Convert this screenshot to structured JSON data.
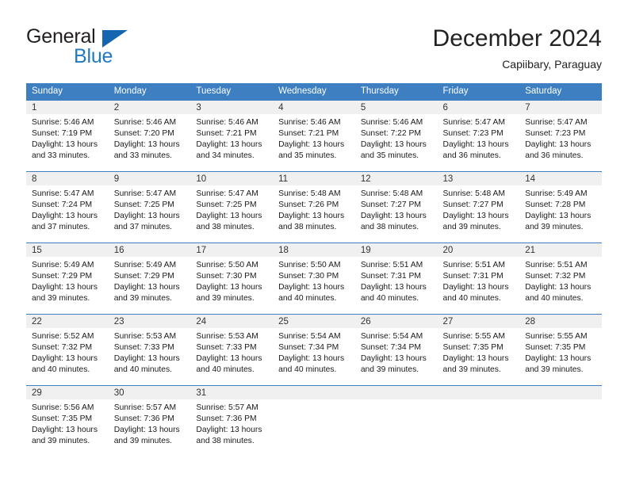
{
  "logo": {
    "primary_text": "General",
    "secondary_text": "Blue",
    "triangle_icon": "triangle-icon",
    "primary_color": "#231f20",
    "secondary_color": "#1f7ac4",
    "triangle_color": "#1565b0"
  },
  "header": {
    "title": "December 2024",
    "subtitle": "Capiibary, Paraguay"
  },
  "theme": {
    "header_bg": "#3d7fc1",
    "header_text": "#ffffff",
    "daynum_bg": "#f0f0f0",
    "row_border": "#3d7fc1",
    "body_text": "#1a1a1a"
  },
  "calendar": {
    "weekday_headers": [
      "Sunday",
      "Monday",
      "Tuesday",
      "Wednesday",
      "Thursday",
      "Friday",
      "Saturday"
    ],
    "weeks": [
      [
        {
          "day": "1",
          "sunrise": "Sunrise: 5:46 AM",
          "sunset": "Sunset: 7:19 PM",
          "daylight_line1": "Daylight: 13 hours",
          "daylight_line2": "and 33 minutes."
        },
        {
          "day": "2",
          "sunrise": "Sunrise: 5:46 AM",
          "sunset": "Sunset: 7:20 PM",
          "daylight_line1": "Daylight: 13 hours",
          "daylight_line2": "and 33 minutes."
        },
        {
          "day": "3",
          "sunrise": "Sunrise: 5:46 AM",
          "sunset": "Sunset: 7:21 PM",
          "daylight_line1": "Daylight: 13 hours",
          "daylight_line2": "and 34 minutes."
        },
        {
          "day": "4",
          "sunrise": "Sunrise: 5:46 AM",
          "sunset": "Sunset: 7:21 PM",
          "daylight_line1": "Daylight: 13 hours",
          "daylight_line2": "and 35 minutes."
        },
        {
          "day": "5",
          "sunrise": "Sunrise: 5:46 AM",
          "sunset": "Sunset: 7:22 PM",
          "daylight_line1": "Daylight: 13 hours",
          "daylight_line2": "and 35 minutes."
        },
        {
          "day": "6",
          "sunrise": "Sunrise: 5:47 AM",
          "sunset": "Sunset: 7:23 PM",
          "daylight_line1": "Daylight: 13 hours",
          "daylight_line2": "and 36 minutes."
        },
        {
          "day": "7",
          "sunrise": "Sunrise: 5:47 AM",
          "sunset": "Sunset: 7:23 PM",
          "daylight_line1": "Daylight: 13 hours",
          "daylight_line2": "and 36 minutes."
        }
      ],
      [
        {
          "day": "8",
          "sunrise": "Sunrise: 5:47 AM",
          "sunset": "Sunset: 7:24 PM",
          "daylight_line1": "Daylight: 13 hours",
          "daylight_line2": "and 37 minutes."
        },
        {
          "day": "9",
          "sunrise": "Sunrise: 5:47 AM",
          "sunset": "Sunset: 7:25 PM",
          "daylight_line1": "Daylight: 13 hours",
          "daylight_line2": "and 37 minutes."
        },
        {
          "day": "10",
          "sunrise": "Sunrise: 5:47 AM",
          "sunset": "Sunset: 7:25 PM",
          "daylight_line1": "Daylight: 13 hours",
          "daylight_line2": "and 38 minutes."
        },
        {
          "day": "11",
          "sunrise": "Sunrise: 5:48 AM",
          "sunset": "Sunset: 7:26 PM",
          "daylight_line1": "Daylight: 13 hours",
          "daylight_line2": "and 38 minutes."
        },
        {
          "day": "12",
          "sunrise": "Sunrise: 5:48 AM",
          "sunset": "Sunset: 7:27 PM",
          "daylight_line1": "Daylight: 13 hours",
          "daylight_line2": "and 38 minutes."
        },
        {
          "day": "13",
          "sunrise": "Sunrise: 5:48 AM",
          "sunset": "Sunset: 7:27 PM",
          "daylight_line1": "Daylight: 13 hours",
          "daylight_line2": "and 39 minutes."
        },
        {
          "day": "14",
          "sunrise": "Sunrise: 5:49 AM",
          "sunset": "Sunset: 7:28 PM",
          "daylight_line1": "Daylight: 13 hours",
          "daylight_line2": "and 39 minutes."
        }
      ],
      [
        {
          "day": "15",
          "sunrise": "Sunrise: 5:49 AM",
          "sunset": "Sunset: 7:29 PM",
          "daylight_line1": "Daylight: 13 hours",
          "daylight_line2": "and 39 minutes."
        },
        {
          "day": "16",
          "sunrise": "Sunrise: 5:49 AM",
          "sunset": "Sunset: 7:29 PM",
          "daylight_line1": "Daylight: 13 hours",
          "daylight_line2": "and 39 minutes."
        },
        {
          "day": "17",
          "sunrise": "Sunrise: 5:50 AM",
          "sunset": "Sunset: 7:30 PM",
          "daylight_line1": "Daylight: 13 hours",
          "daylight_line2": "and 39 minutes."
        },
        {
          "day": "18",
          "sunrise": "Sunrise: 5:50 AM",
          "sunset": "Sunset: 7:30 PM",
          "daylight_line1": "Daylight: 13 hours",
          "daylight_line2": "and 40 minutes."
        },
        {
          "day": "19",
          "sunrise": "Sunrise: 5:51 AM",
          "sunset": "Sunset: 7:31 PM",
          "daylight_line1": "Daylight: 13 hours",
          "daylight_line2": "and 40 minutes."
        },
        {
          "day": "20",
          "sunrise": "Sunrise: 5:51 AM",
          "sunset": "Sunset: 7:31 PM",
          "daylight_line1": "Daylight: 13 hours",
          "daylight_line2": "and 40 minutes."
        },
        {
          "day": "21",
          "sunrise": "Sunrise: 5:51 AM",
          "sunset": "Sunset: 7:32 PM",
          "daylight_line1": "Daylight: 13 hours",
          "daylight_line2": "and 40 minutes."
        }
      ],
      [
        {
          "day": "22",
          "sunrise": "Sunrise: 5:52 AM",
          "sunset": "Sunset: 7:32 PM",
          "daylight_line1": "Daylight: 13 hours",
          "daylight_line2": "and 40 minutes."
        },
        {
          "day": "23",
          "sunrise": "Sunrise: 5:53 AM",
          "sunset": "Sunset: 7:33 PM",
          "daylight_line1": "Daylight: 13 hours",
          "daylight_line2": "and 40 minutes."
        },
        {
          "day": "24",
          "sunrise": "Sunrise: 5:53 AM",
          "sunset": "Sunset: 7:33 PM",
          "daylight_line1": "Daylight: 13 hours",
          "daylight_line2": "and 40 minutes."
        },
        {
          "day": "25",
          "sunrise": "Sunrise: 5:54 AM",
          "sunset": "Sunset: 7:34 PM",
          "daylight_line1": "Daylight: 13 hours",
          "daylight_line2": "and 40 minutes."
        },
        {
          "day": "26",
          "sunrise": "Sunrise: 5:54 AM",
          "sunset": "Sunset: 7:34 PM",
          "daylight_line1": "Daylight: 13 hours",
          "daylight_line2": "and 39 minutes."
        },
        {
          "day": "27",
          "sunrise": "Sunrise: 5:55 AM",
          "sunset": "Sunset: 7:35 PM",
          "daylight_line1": "Daylight: 13 hours",
          "daylight_line2": "and 39 minutes."
        },
        {
          "day": "28",
          "sunrise": "Sunrise: 5:55 AM",
          "sunset": "Sunset: 7:35 PM",
          "daylight_line1": "Daylight: 13 hours",
          "daylight_line2": "and 39 minutes."
        }
      ],
      [
        {
          "day": "29",
          "sunrise": "Sunrise: 5:56 AM",
          "sunset": "Sunset: 7:35 PM",
          "daylight_line1": "Daylight: 13 hours",
          "daylight_line2": "and 39 minutes."
        },
        {
          "day": "30",
          "sunrise": "Sunrise: 5:57 AM",
          "sunset": "Sunset: 7:36 PM",
          "daylight_line1": "Daylight: 13 hours",
          "daylight_line2": "and 39 minutes."
        },
        {
          "day": "31",
          "sunrise": "Sunrise: 5:57 AM",
          "sunset": "Sunset: 7:36 PM",
          "daylight_line1": "Daylight: 13 hours",
          "daylight_line2": "and 38 minutes."
        },
        {
          "day": "",
          "sunrise": "",
          "sunset": "",
          "daylight_line1": "",
          "daylight_line2": ""
        },
        {
          "day": "",
          "sunrise": "",
          "sunset": "",
          "daylight_line1": "",
          "daylight_line2": ""
        },
        {
          "day": "",
          "sunrise": "",
          "sunset": "",
          "daylight_line1": "",
          "daylight_line2": ""
        },
        {
          "day": "",
          "sunrise": "",
          "sunset": "",
          "daylight_line1": "",
          "daylight_line2": ""
        }
      ]
    ]
  }
}
